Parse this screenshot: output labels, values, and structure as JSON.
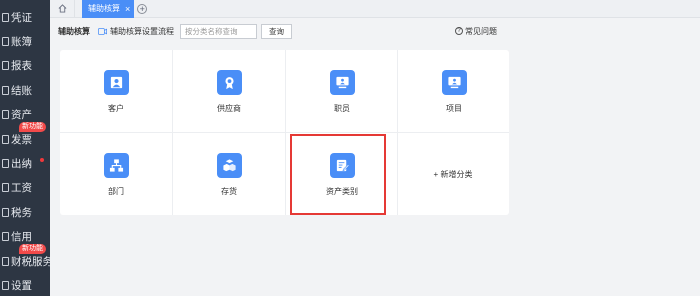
{
  "sidebar": {
    "items": [
      {
        "label": "凭证"
      },
      {
        "label": "账簿"
      },
      {
        "label": "报表"
      },
      {
        "label": "结账"
      },
      {
        "label": "资产"
      },
      {
        "label": "发票",
        "badge": "新功能"
      },
      {
        "label": "出纳",
        "dot": true
      },
      {
        "label": "工资"
      },
      {
        "label": "税务"
      },
      {
        "label": "信用"
      },
      {
        "label": "财税服务",
        "badge": "新功能"
      },
      {
        "label": "设置"
      }
    ]
  },
  "tabs": {
    "active_label": "辅助核算",
    "close_glyph": "×",
    "add_glyph": "+"
  },
  "toolbar": {
    "title": "辅助核算",
    "flow_label": "辅助核算设置流程",
    "search_placeholder": "按分类名称查询",
    "query_button": "查询",
    "help_label": "常见问题",
    "help_glyph": "?"
  },
  "grid": {
    "items": [
      {
        "label": "客户",
        "icon": "person-icon"
      },
      {
        "label": "供应商",
        "icon": "medal-icon"
      },
      {
        "label": "职员",
        "icon": "monitor-user-icon"
      },
      {
        "label": "项目",
        "icon": "monitor-user-icon"
      },
      {
        "label": "部门",
        "icon": "org-chart-icon"
      },
      {
        "label": "存货",
        "icon": "boxes-icon"
      },
      {
        "label": "资产类别",
        "icon": "edit-document-icon"
      }
    ],
    "add_label": "+ 新增分类"
  },
  "colors": {
    "accent": "#4a8ef7",
    "sidebar_bg": "#2d3643",
    "highlight": "#e53935",
    "badge": "#f24a4a"
  }
}
